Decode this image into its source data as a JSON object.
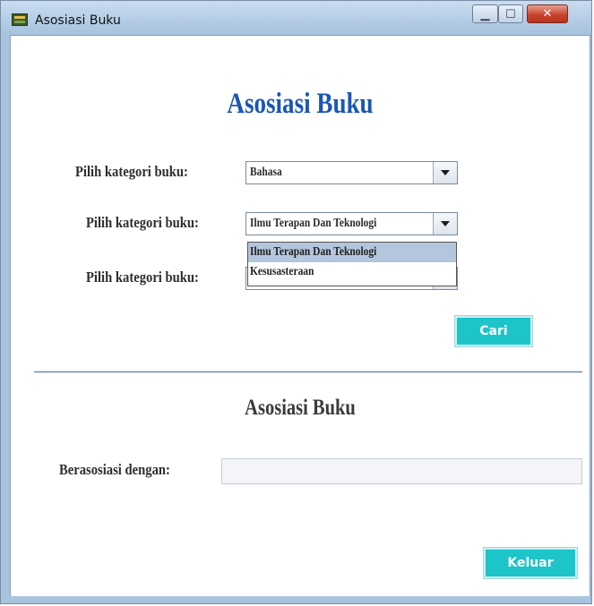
{
  "window": {
    "title": "Asosiasi Buku",
    "minimize_glyph": "▁",
    "maximize_glyph": "☐",
    "close_glyph": "✕"
  },
  "form": {
    "heading": "Asosiasi Buku",
    "rows": [
      {
        "label": "Pilih kategori buku:",
        "value": "Bahasa"
      },
      {
        "label": "Pilih kategori buku:",
        "value": "Ilmu Terapan Dan Teknologi"
      },
      {
        "label": "Pilih kategori buku:",
        "value": ""
      }
    ],
    "dropdown_options": [
      "Ilmu Terapan Dan Teknologi",
      "Kesusasteraan"
    ],
    "search_button": "Cari"
  },
  "result": {
    "heading": "Asosiasi Buku",
    "label": "Berasosiasi dengan:",
    "value": ""
  },
  "footer": {
    "exit_button": "Keluar"
  },
  "colors": {
    "heading_blue": "#1a57b5",
    "button_teal": "#1dc4c8",
    "dropdown_highlight": "#b3c6dd"
  }
}
